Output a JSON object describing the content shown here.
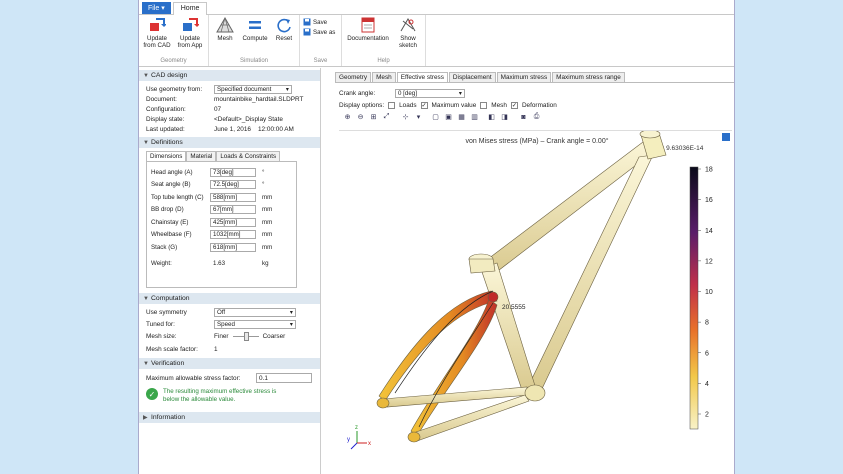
{
  "ribbon": {
    "file_label": "File ▾",
    "home_tab": "Home",
    "groups": {
      "geometry": {
        "name": "Geometry",
        "update_cad": "Update\nfrom CAD",
        "update_app": "Update\nfrom App"
      },
      "simulation": {
        "name": "Simulation",
        "mesh": "Mesh",
        "compute": "Compute",
        "reset": "Reset"
      },
      "save": {
        "name": "Save",
        "save": "Save",
        "save_as": "Save as"
      },
      "help": {
        "name": "Help",
        "documentation": "Documentation",
        "show_sketch": "Show\nsketch"
      }
    }
  },
  "cad": {
    "title": "CAD design",
    "use_geometry_label": "Use geometry from:",
    "use_geometry_value": "Specified document",
    "document_label": "Document:",
    "document_value": "mountainbike_hardtail.SLDPRT",
    "configuration_label": "Configuration:",
    "configuration_value": "07",
    "display_state_label": "Display state:",
    "display_state_value": "<Default>_Display State",
    "last_updated_label": "Last updated:",
    "last_updated_date": "June 1, 2016",
    "last_updated_time": "12:00:00 AM"
  },
  "definitions": {
    "title": "Definitions",
    "tabs": [
      "Dimensions",
      "Material",
      "Loads & Constraints"
    ],
    "rows": [
      {
        "label": "Head angle (A)",
        "value": "73[deg]",
        "unit": "°"
      },
      {
        "label": "Seat angle (B)",
        "value": "72.5[deg]",
        "unit": "°"
      },
      {
        "label": "Top tube length (C)",
        "value": "588[mm]",
        "unit": "mm"
      },
      {
        "label": "BB drop (D)",
        "value": "67[mm]",
        "unit": "mm"
      },
      {
        "label": "Chainstay (E)",
        "value": "425[mm]",
        "unit": "mm"
      },
      {
        "label": "Wheelbase (F)",
        "value": "1032[mm]",
        "unit": "mm"
      },
      {
        "label": "Stack (G)",
        "value": "618[mm]",
        "unit": "mm"
      }
    ],
    "weight_label": "Weight:",
    "weight_value": "1.63",
    "weight_unit": "kg"
  },
  "computation": {
    "title": "Computation",
    "symmetry_label": "Use symmetry",
    "symmetry_value": "Off",
    "tuned_label": "Tuned for:",
    "tuned_value": "Speed",
    "mesh_size_label": "Mesh size:",
    "finer": "Finer",
    "coarser": "Coarser",
    "scale_label": "Mesh scale factor:",
    "scale_value": "1"
  },
  "verification": {
    "title": "Verification",
    "max_stress_label": "Maximum allowable stress factor:",
    "max_stress_value": "0.1",
    "message_line1": "The resulting maximum effective stress is",
    "message_line2": "below the allowable value."
  },
  "information": {
    "title": "Information"
  },
  "graphics": {
    "tabs": [
      "Geometry",
      "Mesh",
      "Effective stress",
      "Displacement",
      "Maximum stress",
      "Maximum stress range"
    ],
    "active_tab": 2,
    "crank_label": "Crank angle:",
    "crank_value": "0 [deg]",
    "display_label": "Display options:",
    "options": [
      {
        "label": "Loads",
        "checked": false
      },
      {
        "label": "Maximum value",
        "checked": true
      },
      {
        "label": "Mesh",
        "checked": false
      },
      {
        "label": "Deformation",
        "checked": true
      }
    ],
    "plot_title": "von Mises stress (MPa) – Crank angle = 0.00°",
    "min_label": "min: 9.63036E-14",
    "max_annotation": "20.5555",
    "colorbar_ticks": [
      "18",
      "16",
      "14",
      "12",
      "10",
      "8",
      "6",
      "4",
      "2"
    ],
    "colors": {
      "low": "#f5efc0",
      "high": "#1a0a2a",
      "mid": "#d94830"
    }
  }
}
